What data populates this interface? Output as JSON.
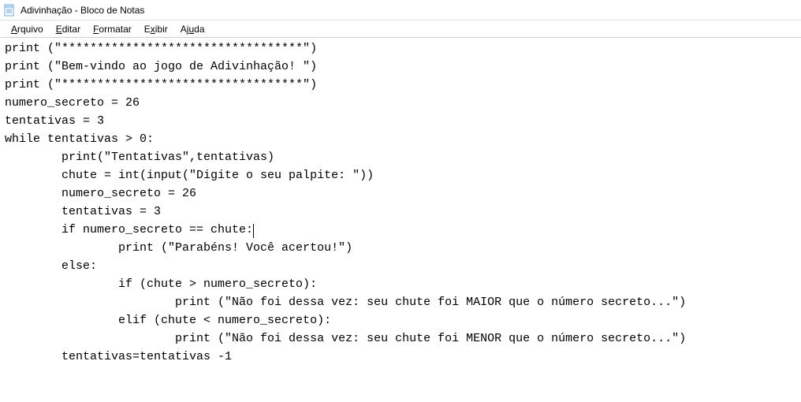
{
  "window": {
    "title": "Adivinhação - Bloco de Notas"
  },
  "menu": {
    "arquivo": "Arquivo",
    "editar": "Editar",
    "formatar": "Formatar",
    "exibir": "Exibir",
    "ajuda": "Ajuda"
  },
  "editor": {
    "lines": [
      "print (\"**********************************\")",
      "print (\"Bem-vindo ao jogo de Adivinhação! \")",
      "print (\"**********************************\")",
      "",
      "numero_secreto = 26",
      "tentativas = 3",
      "",
      "while tentativas > 0:",
      "        print(\"Tentativas\",tentativas)",
      "        chute = int(input(\"Digite o seu palpite: \"))",
      "        numero_secreto = 26",
      "        tentativas = 3",
      "        if numero_secreto == chute:",
      "                print (\"Parabéns! Você acertou!\")",
      "        else:",
      "                if (chute > numero_secreto):",
      "                        print (\"Não foi dessa vez: seu chute foi MAIOR que o número secreto...\")",
      "                elif (chute < numero_secreto):",
      "                        print (\"Não foi dessa vez: seu chute foi MENOR que o número secreto...\")",
      "        tentativas=tentativas -1"
    ],
    "caret_line_index": 12,
    "caret_after_text": "        if numero_secreto == chute:"
  }
}
